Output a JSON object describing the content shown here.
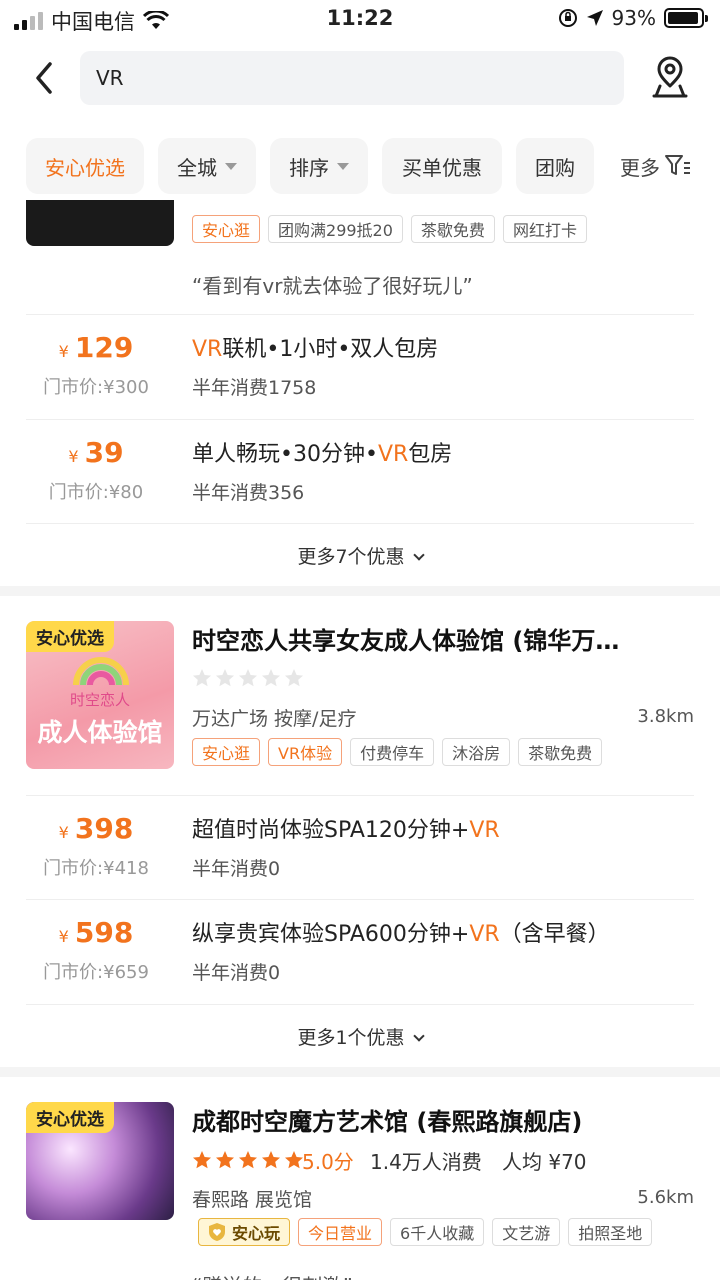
{
  "status_bar": {
    "carrier": "中国电信",
    "time": "11:22",
    "battery": "93%",
    "battery_level": 0.93
  },
  "search": {
    "query": "VR"
  },
  "filters": {
    "items": [
      {
        "label": "安心优选",
        "active": true
      },
      {
        "label": "全城",
        "dropdown": true
      },
      {
        "label": "排序",
        "dropdown": true
      },
      {
        "label": "买单优惠"
      },
      {
        "label": "团购"
      }
    ],
    "more_label": "更多"
  },
  "shop1": {
    "tags": [
      "安心逛",
      "团购满299抵20",
      "茶歇免费",
      "网红打卡"
    ],
    "review": "“看到有vr就去体验了很好玩儿”",
    "deals": [
      {
        "price": "129",
        "orig": "门市价:¥300",
        "title_hl": "VR",
        "title_rest": "联机•1小时•双人包房",
        "sales": "半年消费1758"
      },
      {
        "price": "39",
        "orig": "门市价:¥80",
        "title_pre": "单人畅玩•30分钟•",
        "title_hl": "VR",
        "title_rest": "包房",
        "sales": "半年消费356"
      }
    ],
    "more": "更多7个优惠"
  },
  "shop2": {
    "badge": "安心优选",
    "thumb_line1": "时空恋人",
    "thumb_line2": "成人体验馆",
    "title": "时空恋人共享女友成人体验馆 (锦华万…",
    "rating": 0,
    "meta": "万达广场  按摩/足疗",
    "distance": "3.8km",
    "tags": [
      "安心逛",
      "VR体验",
      "付费停车",
      "沐浴房",
      "茶歇免费"
    ],
    "deals": [
      {
        "price": "398",
        "orig": "门市价:¥418",
        "title_pre": "超值时尚体验SPA120分钟+",
        "title_hl": "VR",
        "title_rest": "",
        "sales": "半年消费0"
      },
      {
        "price": "598",
        "orig": "门市价:¥659",
        "title_pre": "纵享贵宾体验SPA600分钟+",
        "title_hl": "VR",
        "title_rest": "（含早餐）",
        "sales": "半年消费0"
      }
    ],
    "more": "更多1个优惠"
  },
  "shop3": {
    "badge": "安心优选",
    "title": "成都时空魔方艺术馆 (春熙路旗舰店)",
    "rating": 5,
    "score": "5.0分",
    "consumption": "1.4万人消费",
    "avg": "人均 ¥70",
    "meta": "春熙路  展览馆",
    "distance": "5.6km",
    "tags": [
      "安心玩",
      "今日营业",
      "6千人收藏",
      "文艺游",
      "拍照圣地"
    ],
    "review": "“赠送的一很刺激”"
  },
  "colors": {
    "accent": "#f2731d",
    "badge_yellow": "#ffd84a"
  }
}
